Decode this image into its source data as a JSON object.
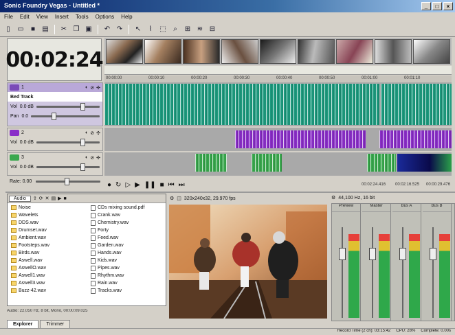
{
  "window": {
    "title": "Sonic Foundry Vegas - Untitled *"
  },
  "menu": {
    "items": [
      "File",
      "Edit",
      "View",
      "Insert",
      "Tools",
      "Options",
      "Help"
    ]
  },
  "colors": {
    "audio_wave": "#1d9a7e",
    "purple_track": "#8a2fc8",
    "green_clip": "#3aa84e",
    "selected_track": "#b9a8d8"
  },
  "timecode": {
    "value": "00:02:24"
  },
  "ruler": {
    "labels": [
      "00:00:00",
      "00:00:10",
      "00:00:20",
      "00:00:30",
      "00:00:40",
      "00:00:50",
      "00:01:00",
      "00:01:10"
    ]
  },
  "tracks": [
    {
      "number": "1",
      "name": "Bed Track",
      "vol_label": "Vol",
      "vol_value": "0.0 dB",
      "pan_label": "Pan",
      "pan_value": "0.0"
    },
    {
      "number": "2",
      "vol_label": "Vol",
      "vol_value": "0.0 dB"
    },
    {
      "number": "3",
      "vol_label": "Vol",
      "vol_value": "0.0 dB"
    }
  ],
  "rate": {
    "label": "Rate: 0.00"
  },
  "transport": {
    "icons": [
      "record-icon",
      "loop-icon",
      "play-from-start-icon",
      "play-icon",
      "pause-icon",
      "stop-icon",
      "prev-marker-icon",
      "next-marker-icon"
    ],
    "tc_position": "00:02:24.416",
    "tc_selection": "00:02:16.525",
    "tc_length": "00:00:29.476"
  },
  "explorer": {
    "dropdown": "Audio",
    "folders": [
      "Noise",
      "Wavelets",
      "DDS.wav",
      "Drumset.wav",
      "Ambient.wav",
      "Footsteps.wav",
      "Birds.wav",
      "Aswell.wav",
      "AswellO.wav",
      "Aswell1.wav",
      "Aswell3.wav",
      "Buzz-42.wav"
    ],
    "files": [
      "CDs mixing sound.pdf",
      "Crank.wav",
      "Chemistry.wav",
      "Forty",
      "Feed.wav",
      "Garden.wav",
      "Hands.wav",
      "Kids.wav",
      "Pipes.wav",
      "Rhythm.wav",
      "Rain.wav",
      "Tracks.wav"
    ],
    "status": "Audio: 22,050 Hz, 8 bit, Mono, 00:00:09.025",
    "tabs": [
      "Explorer",
      "Trimmer"
    ]
  },
  "preview": {
    "info": "320x240x32, 29.970 fps"
  },
  "mixer": {
    "info": "44,100 Hz, 16 bit",
    "strips": [
      "Preview",
      "Master",
      "Bus A",
      "Bus B"
    ]
  },
  "status": {
    "record_time": "Record Time (2 ch): 03:15:42",
    "cpu": "CPU: 28%",
    "complete": "Complete: 0.00s"
  }
}
